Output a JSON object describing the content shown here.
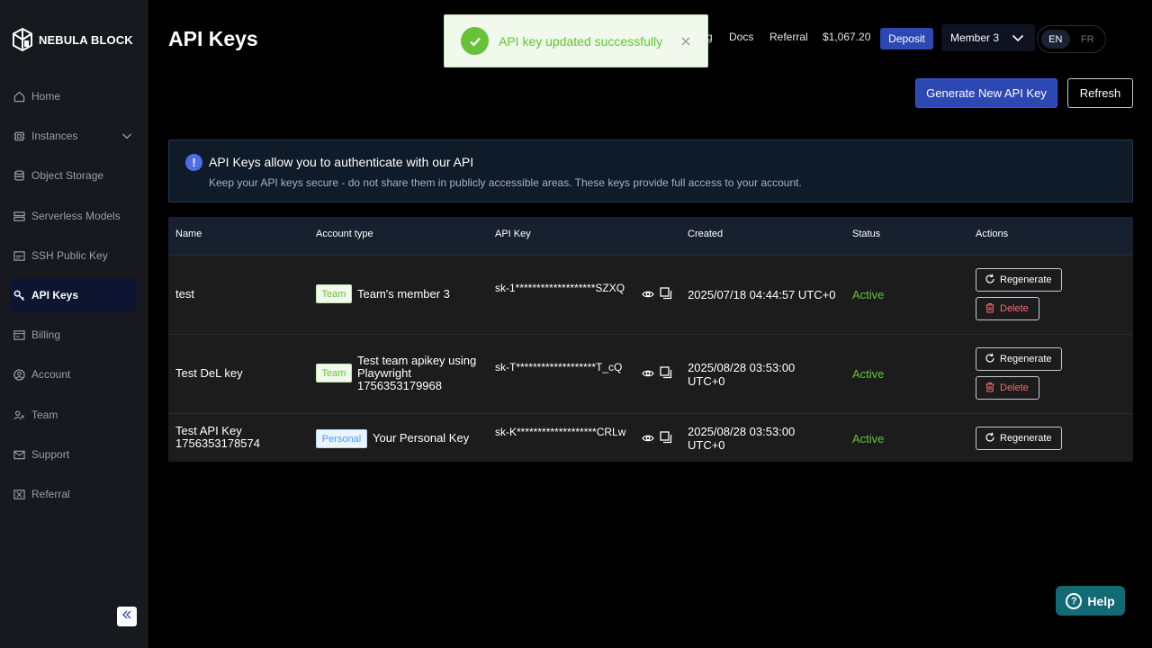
{
  "brand": {
    "name": "NEBULA BLOCK"
  },
  "sidebar": {
    "items": [
      {
        "label": "Home",
        "icon": "home-icon"
      },
      {
        "label": "Instances",
        "icon": "chip-icon"
      },
      {
        "label": "Object Storage",
        "icon": "database-icon"
      },
      {
        "label": "Serverless Models",
        "icon": "server-icon"
      },
      {
        "label": "SSH Public Key",
        "icon": "ssh-icon"
      },
      {
        "label": "API Keys",
        "icon": "key-icon"
      },
      {
        "label": "Billing",
        "icon": "billing-icon"
      },
      {
        "label": "Account",
        "icon": "account-icon"
      },
      {
        "label": "Team",
        "icon": "team-icon"
      },
      {
        "label": "Support",
        "icon": "mail-icon"
      },
      {
        "label": "Referral",
        "icon": "referral-icon"
      }
    ],
    "active": "API Keys"
  },
  "header": {
    "title": "API Keys",
    "partial_link": "g",
    "docs": "Docs",
    "referral": "Referral",
    "balance": "$1,067.20",
    "deposit": "Deposit",
    "member": "Member 3",
    "lang_en": "EN",
    "lang_fr": "FR"
  },
  "toast": {
    "message": "API key updated successfully"
  },
  "actions": {
    "generate": "Generate New API Key",
    "refresh": "Refresh"
  },
  "info": {
    "title": "API Keys allow you to authenticate with our API",
    "description": "Keep your API keys secure - do not share them in publicly accessible areas. These keys provide full access to your account."
  },
  "table": {
    "headers": {
      "name": "Name",
      "account_type": "Account type",
      "api_key": "API Key",
      "created": "Created",
      "status": "Status",
      "actions": "Actions"
    },
    "regenerate_label": "Regenerate",
    "delete_label": "Delete",
    "rows": [
      {
        "name": "test",
        "type_tag": "Team",
        "type_desc": "Team's member 3",
        "key": "sk-1*******************SZXQ",
        "created": "2025/07/18 04:44:57 UTC+0",
        "status": "Active"
      },
      {
        "name": "Test DeL key",
        "type_tag": "Team",
        "type_desc": "Test team apikey using Playwright 1756353179968",
        "key": "sk-T*******************T_cQ",
        "created": "2025/08/28 03:53:00 UTC+0",
        "status": "Active"
      },
      {
        "name": "Test API Key 1756353178574",
        "type_tag": "Personal",
        "type_desc": "Your Personal Key",
        "key": "sk-K*******************CRLw",
        "created": "2025/08/28 03:53:00 UTC+0",
        "status": "Active"
      }
    ]
  },
  "help": {
    "label": "Help"
  },
  "colors": {
    "accent": "#2c48b3",
    "success": "#67c23a",
    "danger": "#f56c6c",
    "sidebar_bg": "#17191e"
  }
}
